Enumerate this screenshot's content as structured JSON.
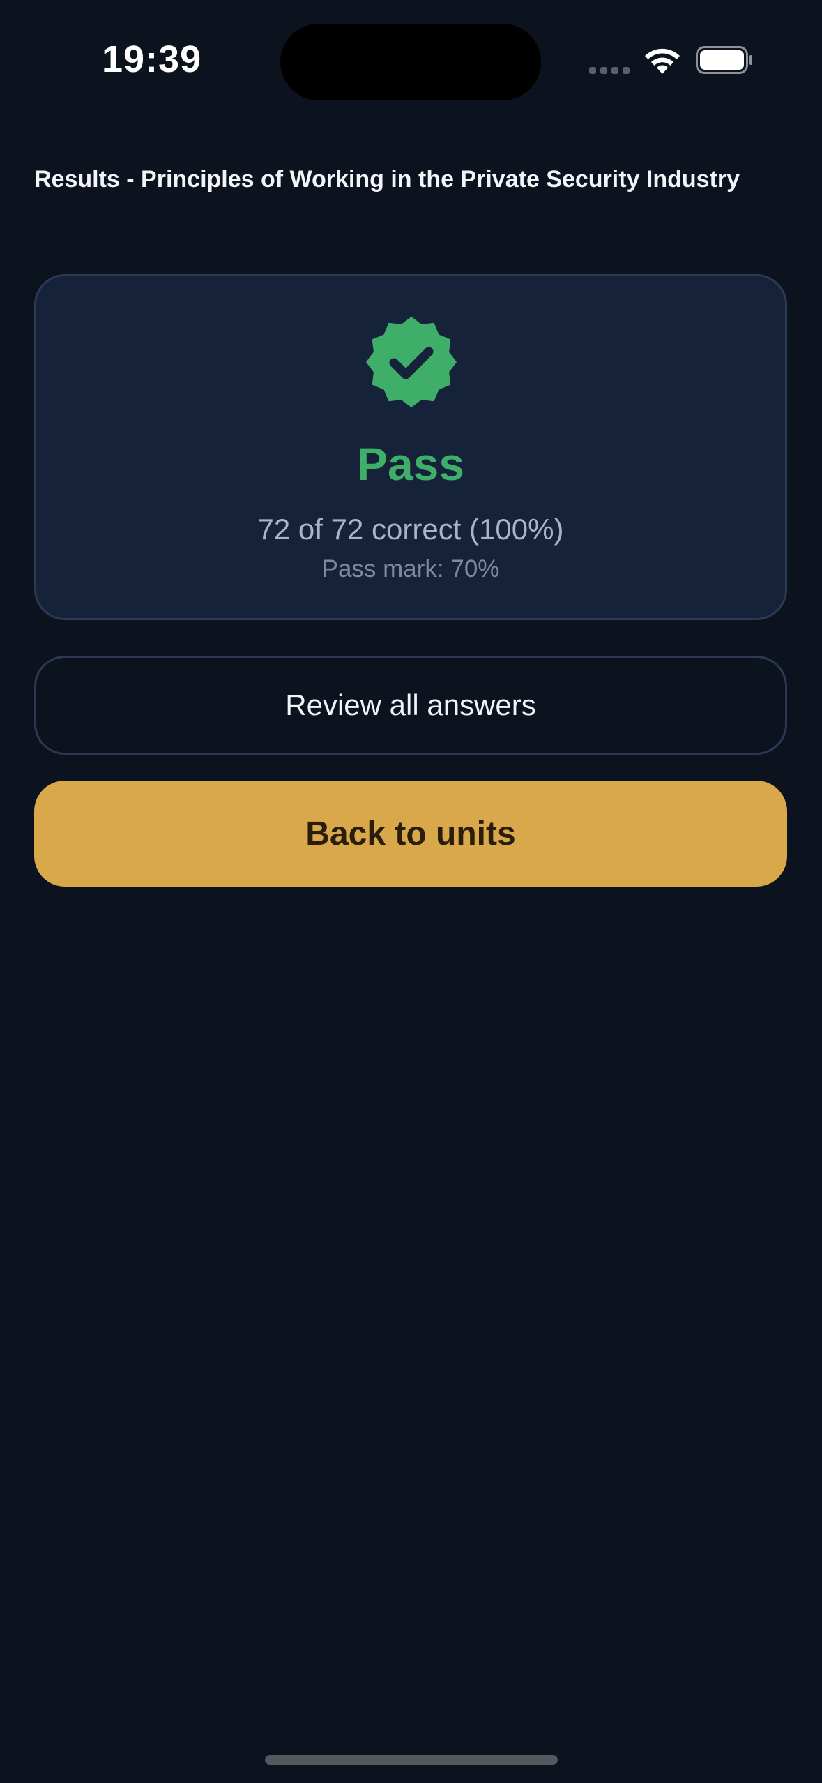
{
  "status_bar": {
    "time": "19:39",
    "icons": [
      "signal-dots-icon",
      "wifi-icon",
      "battery-icon"
    ]
  },
  "header": {
    "title": "Results - Principles of Working in the Private Security Industry"
  },
  "result_card": {
    "icon": "check-badge-icon",
    "status": "Pass",
    "score": "72 of 72 correct (100%)",
    "pass_mark": "Pass mark: 70%"
  },
  "actions": {
    "review_label": "Review all answers",
    "back_label": "Back to units"
  },
  "colors": {
    "background": "#0d131e",
    "card": "#16213a",
    "card_border": "#2b3952",
    "pass_green": "#3eae69",
    "accent_gold": "#d8a84a"
  }
}
